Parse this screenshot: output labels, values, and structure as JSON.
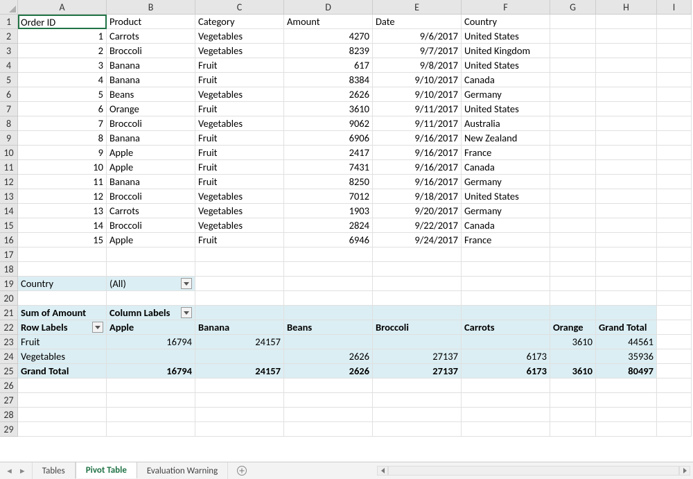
{
  "columns": [
    "A",
    "B",
    "C",
    "D",
    "E",
    "F",
    "G",
    "H",
    "I"
  ],
  "row_count": 29,
  "selected_cell": "A1",
  "data_table": {
    "headers": [
      "Order ID",
      "Product",
      "Category",
      "Amount",
      "Date",
      "Country"
    ],
    "rows": [
      {
        "order_id": 1,
        "product": "Carrots",
        "category": "Vegetables",
        "amount": 4270,
        "date": "9/6/2017",
        "country": "United States"
      },
      {
        "order_id": 2,
        "product": "Broccoli",
        "category": "Vegetables",
        "amount": 8239,
        "date": "9/7/2017",
        "country": "United Kingdom"
      },
      {
        "order_id": 3,
        "product": "Banana",
        "category": "Fruit",
        "amount": 617,
        "date": "9/8/2017",
        "country": "United States"
      },
      {
        "order_id": 4,
        "product": "Banana",
        "category": "Fruit",
        "amount": 8384,
        "date": "9/10/2017",
        "country": "Canada"
      },
      {
        "order_id": 5,
        "product": "Beans",
        "category": "Vegetables",
        "amount": 2626,
        "date": "9/10/2017",
        "country": "Germany"
      },
      {
        "order_id": 6,
        "product": "Orange",
        "category": "Fruit",
        "amount": 3610,
        "date": "9/11/2017",
        "country": "United States"
      },
      {
        "order_id": 7,
        "product": "Broccoli",
        "category": "Vegetables",
        "amount": 9062,
        "date": "9/11/2017",
        "country": "Australia"
      },
      {
        "order_id": 8,
        "product": "Banana",
        "category": "Fruit",
        "amount": 6906,
        "date": "9/16/2017",
        "country": "New Zealand"
      },
      {
        "order_id": 9,
        "product": "Apple",
        "category": "Fruit",
        "amount": 2417,
        "date": "9/16/2017",
        "country": "France"
      },
      {
        "order_id": 10,
        "product": "Apple",
        "category": "Fruit",
        "amount": 7431,
        "date": "9/16/2017",
        "country": "Canada"
      },
      {
        "order_id": 11,
        "product": "Banana",
        "category": "Fruit",
        "amount": 8250,
        "date": "9/16/2017",
        "country": "Germany"
      },
      {
        "order_id": 12,
        "product": "Broccoli",
        "category": "Vegetables",
        "amount": 7012,
        "date": "9/18/2017",
        "country": "United States"
      },
      {
        "order_id": 13,
        "product": "Carrots",
        "category": "Vegetables",
        "amount": 1903,
        "date": "9/20/2017",
        "country": "Germany"
      },
      {
        "order_id": 14,
        "product": "Broccoli",
        "category": "Vegetables",
        "amount": 2824,
        "date": "9/22/2017",
        "country": "Canada"
      },
      {
        "order_id": 15,
        "product": "Apple",
        "category": "Fruit",
        "amount": 6946,
        "date": "9/24/2017",
        "country": "France"
      }
    ]
  },
  "pivot": {
    "filter_label": "Country",
    "filter_value": "(All)",
    "measure_label": "Sum of Amount",
    "column_labels_label": "Column Labels",
    "row_labels_label": "Row Labels",
    "columns": [
      "Apple",
      "Banana",
      "Beans",
      "Broccoli",
      "Carrots",
      "Orange",
      "Grand Total"
    ],
    "rows": [
      {
        "label": "Fruit",
        "values": {
          "Apple": 16794,
          "Banana": 24157,
          "Orange": 3610,
          "Grand Total": 44561
        }
      },
      {
        "label": "Vegetables",
        "values": {
          "Beans": 2626,
          "Broccoli": 27137,
          "Carrots": 6173,
          "Grand Total": 35936
        }
      }
    ],
    "grand_total_label": "Grand Total",
    "grand_total": {
      "Apple": 16794,
      "Banana": 24157,
      "Beans": 2626,
      "Broccoli": 27137,
      "Carrots": 6173,
      "Orange": 3610,
      "Grand Total": 80497
    }
  },
  "tabs": {
    "items": [
      "Tables",
      "Pivot Table",
      "Evaluation Warning"
    ],
    "active": "Pivot Table"
  },
  "chart_data": {
    "type": "table",
    "title": "Sum of Amount by Category and Product",
    "columns": [
      "Apple",
      "Banana",
      "Beans",
      "Broccoli",
      "Carrots",
      "Orange",
      "Grand Total"
    ],
    "rows": [
      "Fruit",
      "Vegetables",
      "Grand Total"
    ],
    "values": [
      [
        16794,
        24157,
        null,
        null,
        null,
        3610,
        44561
      ],
      [
        null,
        null,
        2626,
        27137,
        6173,
        null,
        35936
      ],
      [
        16794,
        24157,
        2626,
        27137,
        6173,
        3610,
        80497
      ]
    ]
  }
}
